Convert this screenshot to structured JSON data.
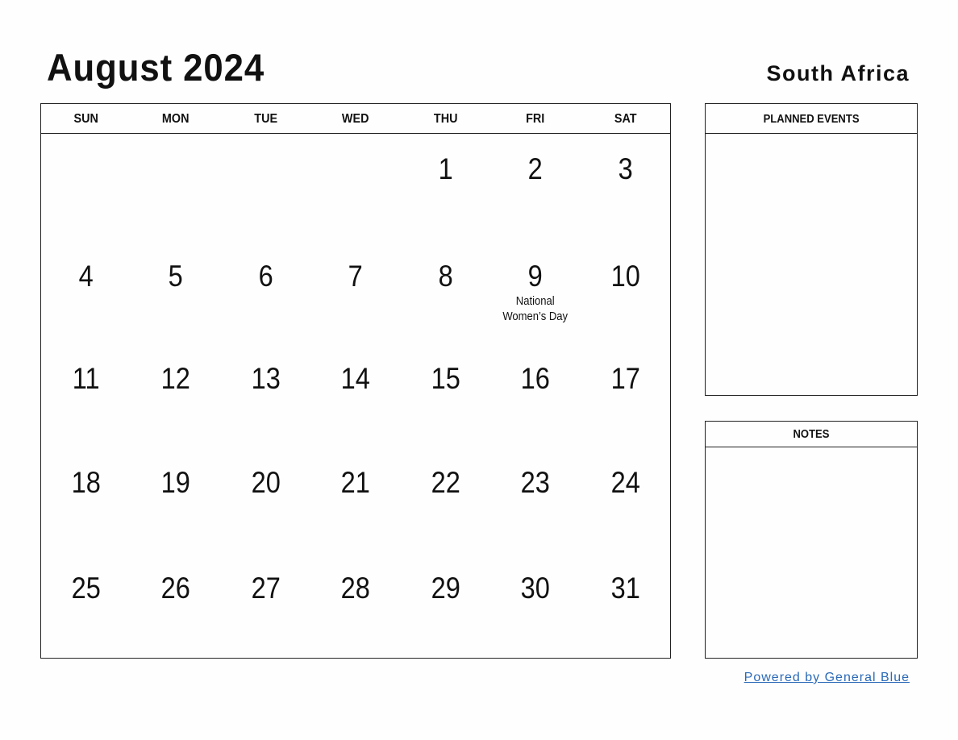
{
  "header": {
    "title": "August 2024",
    "country": "South Africa"
  },
  "calendar": {
    "weekdays": [
      "SUN",
      "MON",
      "TUE",
      "WED",
      "THU",
      "FRI",
      "SAT"
    ],
    "cells": [
      {
        "day": "",
        "holiday": ""
      },
      {
        "day": "",
        "holiday": ""
      },
      {
        "day": "",
        "holiday": ""
      },
      {
        "day": "",
        "holiday": ""
      },
      {
        "day": "1",
        "holiday": ""
      },
      {
        "day": "2",
        "holiday": ""
      },
      {
        "day": "3",
        "holiday": ""
      },
      {
        "day": "4",
        "holiday": ""
      },
      {
        "day": "5",
        "holiday": ""
      },
      {
        "day": "6",
        "holiday": ""
      },
      {
        "day": "7",
        "holiday": ""
      },
      {
        "day": "8",
        "holiday": ""
      },
      {
        "day": "9",
        "holiday": "National Women’s Day"
      },
      {
        "day": "10",
        "holiday": ""
      },
      {
        "day": "11",
        "holiday": ""
      },
      {
        "day": "12",
        "holiday": ""
      },
      {
        "day": "13",
        "holiday": ""
      },
      {
        "day": "14",
        "holiday": ""
      },
      {
        "day": "15",
        "holiday": ""
      },
      {
        "day": "16",
        "holiday": ""
      },
      {
        "day": "17",
        "holiday": ""
      },
      {
        "day": "18",
        "holiday": ""
      },
      {
        "day": "19",
        "holiday": ""
      },
      {
        "day": "20",
        "holiday": ""
      },
      {
        "day": "21",
        "holiday": ""
      },
      {
        "day": "22",
        "holiday": ""
      },
      {
        "day": "23",
        "holiday": ""
      },
      {
        "day": "24",
        "holiday": ""
      },
      {
        "day": "25",
        "holiday": ""
      },
      {
        "day": "26",
        "holiday": ""
      },
      {
        "day": "27",
        "holiday": ""
      },
      {
        "day": "28",
        "holiday": ""
      },
      {
        "day": "29",
        "holiday": ""
      },
      {
        "day": "30",
        "holiday": ""
      },
      {
        "day": "31",
        "holiday": ""
      }
    ]
  },
  "panels": {
    "planned_events": "PLANNED EVENTS",
    "notes": "NOTES"
  },
  "footer": {
    "link_text": "Powered by General Blue",
    "link_color": "#2a6ab8"
  }
}
